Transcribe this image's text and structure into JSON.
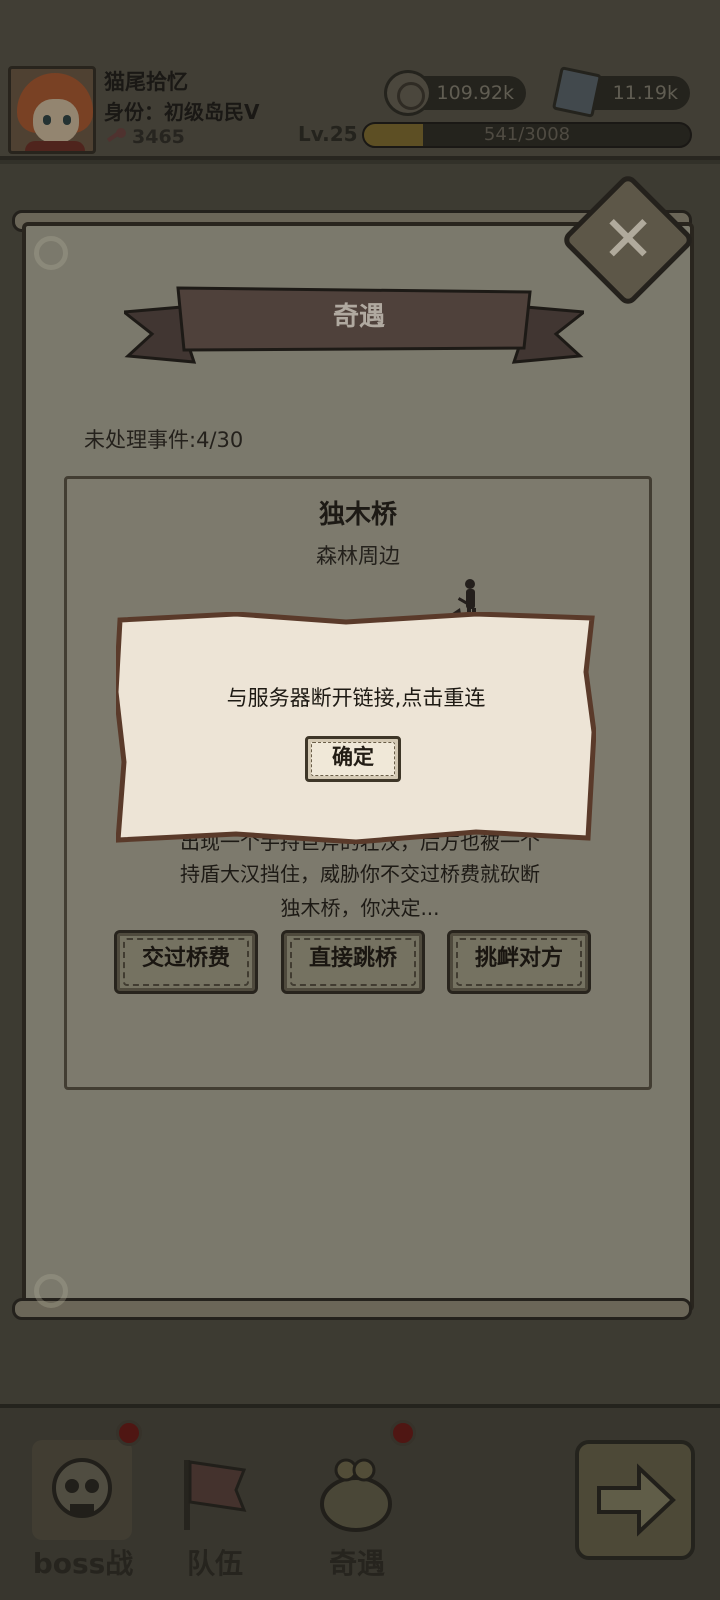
{
  "player": {
    "name": "猫尾拾忆",
    "title": "身份：初级岛民Ⅴ",
    "keys": "3465",
    "level": "Lv.25",
    "xp_text": "541/3008",
    "xp_fraction": 0.18
  },
  "currency": {
    "coins": "109.92k",
    "gems": "11.19k"
  },
  "panel": {
    "title": "奇遇",
    "pending_events": "未处理事件:4/30"
  },
  "event": {
    "name": "独木桥",
    "location": "森林周边",
    "description_lines": [
      "出现一个手持巨斧的壮汉，后方也被一个",
      "持盾大汉挡住，威胁你不交过桥费就砍断",
      "独木桥，你决定..."
    ],
    "choices": [
      "交过桥费",
      "直接跳桥",
      "挑衅对方"
    ]
  },
  "dialog": {
    "message": "与服务器断开链接,点击重连",
    "confirm_label": "确定"
  },
  "nav": {
    "items": [
      {
        "label": "boss战",
        "has_badge": true
      },
      {
        "label": "队伍",
        "has_badge": false
      },
      {
        "label": "奇遇",
        "has_badge": true
      }
    ]
  },
  "icons": {
    "close": "close-icon",
    "coin": "coin-icon",
    "gem": "gem-icon",
    "key": "key-icon",
    "next": "arrow-right-icon"
  },
  "colors": {
    "parchment": "#ede4d6",
    "dialog_border": "#5a3a2a",
    "ribbon": "#5a4a44"
  }
}
